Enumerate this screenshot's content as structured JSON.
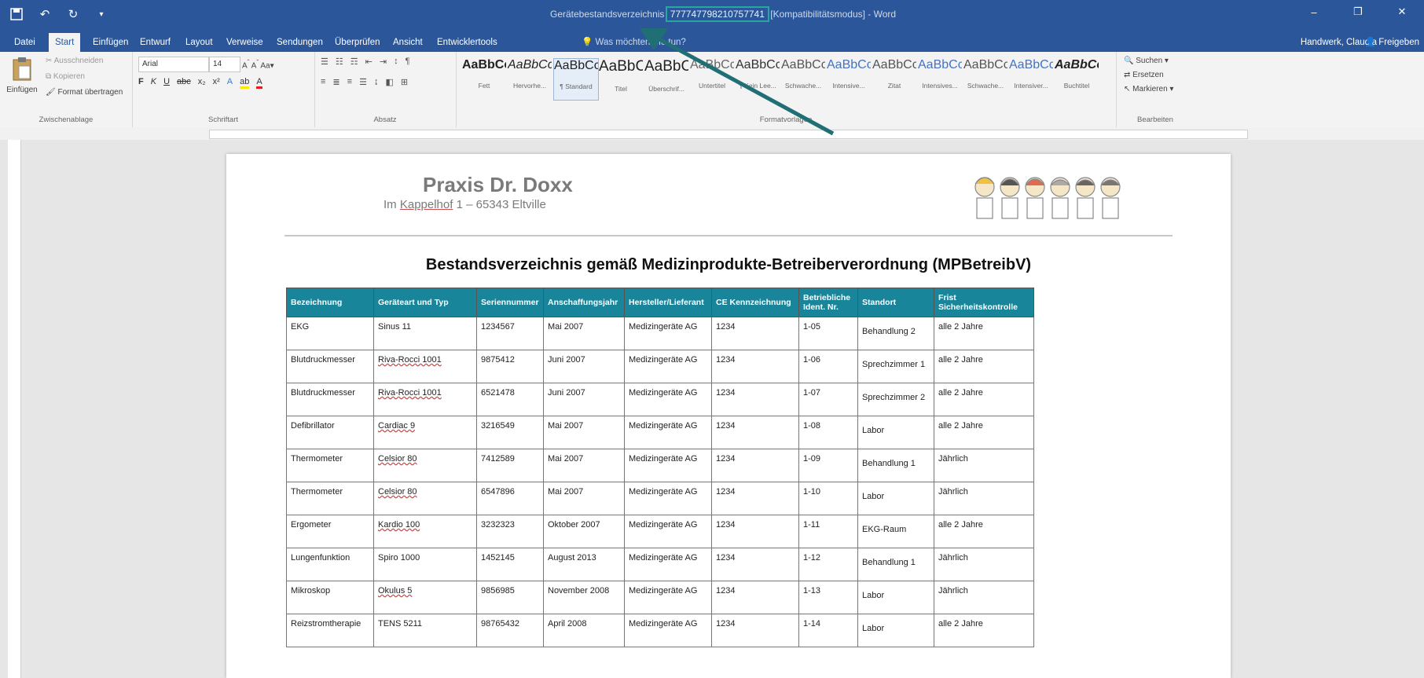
{
  "titlebar": {
    "title_prefix": "Gerätebestandsverzeichnis",
    "title_highlight": "777747798210757741",
    "title_suffix": "[Kompatibilitätsmodus] - Word",
    "minimize": "–",
    "restore": "❐",
    "close": "✕"
  },
  "tabs": [
    "Datei",
    "Start",
    "Einfügen",
    "Entwurf",
    "Layout",
    "Verweise",
    "Sendungen",
    "Überprüfen",
    "Ansicht",
    "Entwicklertools"
  ],
  "tell_me": "Was möchten Sie tun?",
  "user": "Handwerk, Claudia",
  "share": "Freigeben",
  "ribbon": {
    "clipboard": {
      "paste": "Einfügen",
      "cut": "Ausschneiden",
      "copy": "Kopieren",
      "format_painter": "Format übertragen",
      "label": "Zwischenablage"
    },
    "font": {
      "name": "Arial",
      "size": "14",
      "label": "Schriftart"
    },
    "paragraph": {
      "label": "Absatz"
    },
    "styles": {
      "label": "Formatvorlagen",
      "items": [
        {
          "preview": "AaBbCc",
          "name": "Fett"
        },
        {
          "preview": "AaBbCc",
          "name": "Hervorhe..."
        },
        {
          "preview": "AaBbCc",
          "name": "¶ Standard"
        },
        {
          "preview": "AaBbC",
          "name": "Titel"
        },
        {
          "preview": "AaBbC",
          "name": "Überschrif..."
        },
        {
          "preview": "AaBbCcD",
          "name": "Untertitel"
        },
        {
          "preview": "AaBbCc",
          "name": "¶ Kein Lee..."
        },
        {
          "preview": "AaBbCc",
          "name": "Schwache..."
        },
        {
          "preview": "AaBbCc",
          "name": "Intensive..."
        },
        {
          "preview": "AaBbCc",
          "name": "Zitat"
        },
        {
          "preview": "AaBbCc",
          "name": "Intensives..."
        },
        {
          "preview": "AaBbCc",
          "name": "Schwache..."
        },
        {
          "preview": "AaBbCc",
          "name": "Intensiver..."
        },
        {
          "preview": "AaBbCc",
          "name": "Buchtitel"
        }
      ]
    },
    "editing": {
      "find": "Suchen",
      "replace": "Ersetzen",
      "select": "Markieren",
      "label": "Bearbeiten"
    }
  },
  "document": {
    "practice_name": "Praxis Dr. Doxx",
    "address_prefix": "Im",
    "address_street": "Kappelhof",
    "address_rest": "1 – 65343 Eltville",
    "heading": "Bestandsverzeichnis gemäß Medizinprodukte-Betreiberverordnung (MPBetreibV)",
    "columns": [
      "Bezeichnung",
      "Geräteart und Typ",
      "Seriennummer",
      "Anschaffungsjahr",
      "Hersteller/Lieferant",
      "CE Kennzeichnung",
      "Betriebliche Ident. Nr.",
      "Standort",
      "Frist Sicherheitskontrolle"
    ],
    "rows": [
      [
        "EKG",
        "Sinus 11",
        "1234567",
        "Mai 2007",
        "Medizingeräte AG",
        "1234",
        "1-05",
        "Behandlung 2",
        "alle 2 Jahre"
      ],
      [
        "Blutdruckmesser",
        "Riva-Rocci 1001",
        "9875412",
        "Juni 2007",
        "Medizingeräte AG",
        "1234",
        "1-06",
        "Sprechzimmer 1",
        "alle 2 Jahre"
      ],
      [
        "Blutdruckmesser",
        "Riva-Rocci 1001",
        "6521478",
        "Juni 2007",
        "Medizingeräte AG",
        "1234",
        "1-07",
        "Sprechzimmer 2",
        "alle 2 Jahre"
      ],
      [
        "Defibrillator",
        "Cardiac 9",
        "3216549",
        "Mai 2007",
        "Medizingeräte AG",
        "1234",
        "1-08",
        "Labor",
        "alle 2 Jahre"
      ],
      [
        "Thermometer",
        "Celsior 80",
        "7412589",
        "Mai 2007",
        "Medizingeräte AG",
        "1234",
        "1-09",
        "Behandlung 1",
        "Jährlich"
      ],
      [
        "Thermometer",
        "Celsior 80",
        "6547896",
        "Mai 2007",
        "Medizingeräte AG",
        "1234",
        "1-10",
        "Labor",
        "Jährlich"
      ],
      [
        "Ergometer",
        "Kardio 100",
        "3232323",
        "Oktober 2007",
        "Medizingeräte AG",
        "1234",
        "1-11",
        "EKG-Raum",
        "alle 2 Jahre"
      ],
      [
        "Lungenfunktion",
        "Spiro 1000",
        "1452145",
        "August 2013",
        "Medizingeräte AG",
        "1234",
        "1-12",
        "Behandlung 1",
        "Jährlich"
      ],
      [
        "Mikroskop",
        "Okulus 5",
        "9856985",
        "November 2008",
        "Medizingeräte AG",
        "1234",
        "1-13",
        "Labor",
        "Jährlich"
      ],
      [
        "Reizstromtherapie",
        "TENS 5211",
        "98765432",
        "April 2008",
        "Medizingeräte AG",
        "1234",
        "1-14",
        "Labor",
        "alle 2 Jahre"
      ]
    ]
  },
  "colors": {
    "title_bar": "#2b579a",
    "table_header": "#18859a",
    "arrow": "#1f6f74"
  }
}
